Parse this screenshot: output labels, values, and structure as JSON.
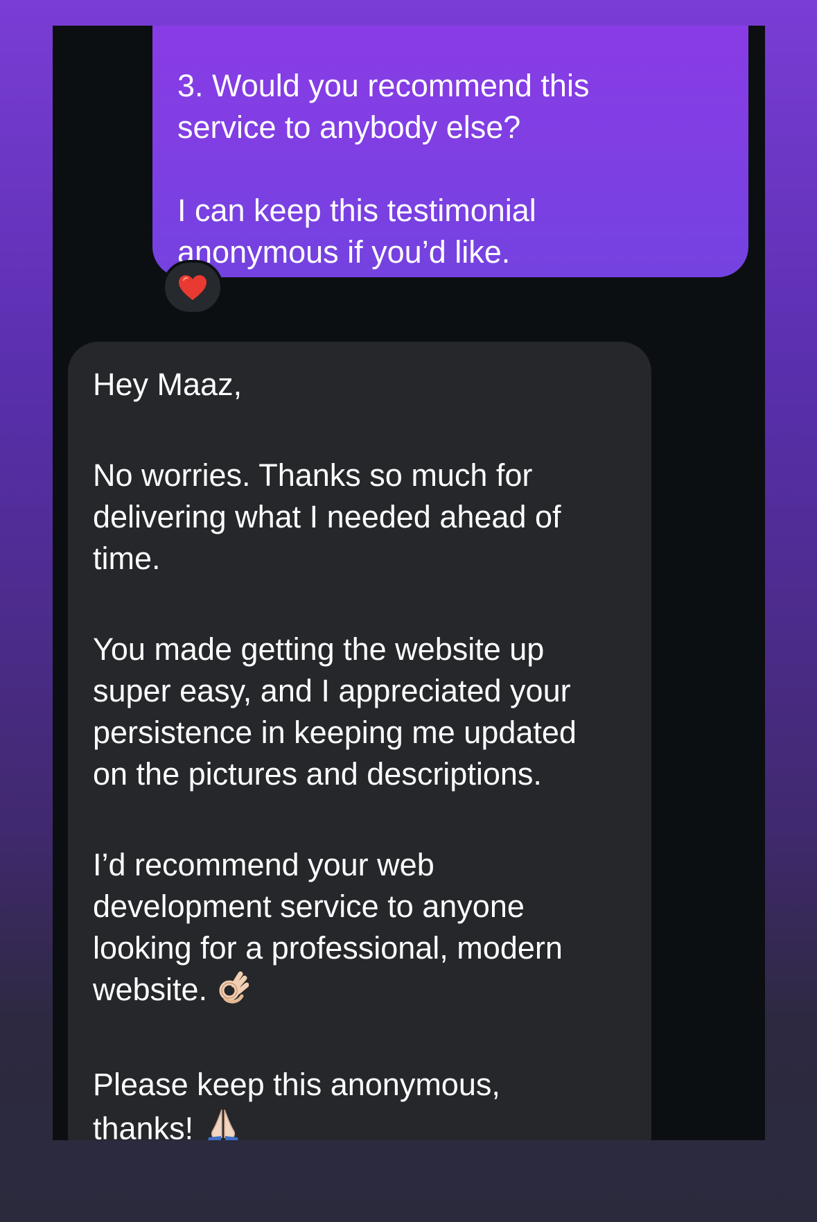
{
  "conversation": {
    "outgoing": {
      "text": "3. Would you recommend this\nservice to anybody else?\n\nI can keep this testimonial\nanonymous if you’d like.",
      "reaction": "red-heart-icon"
    },
    "incoming": {
      "paragraphs": [
        "Hey Maaz,",
        "No worries. Thanks so much for\ndelivering what I needed ahead of\ntime.",
        "You made getting the website up\nsuper easy, and I appreciated your\npersistence in keeping me updated\non the pictures and descriptions.",
        "I’d recommend your web\ndevelopment service to anyone\nlooking for a professional, modern\nwebsite.",
        "Please keep this anonymous,\nthanks!"
      ],
      "emojis": {
        "ok_hand": "ok-hand-icon",
        "folded_hands": "folded-hands-icon"
      }
    }
  },
  "colors": {
    "outgoing_bubble": "#8b3be6",
    "incoming_bubble": "#25272b",
    "thread_background": "#0c0f12",
    "page_gradient_top": "#7a3dd6",
    "page_gradient_bottom": "#2b2a3d"
  }
}
